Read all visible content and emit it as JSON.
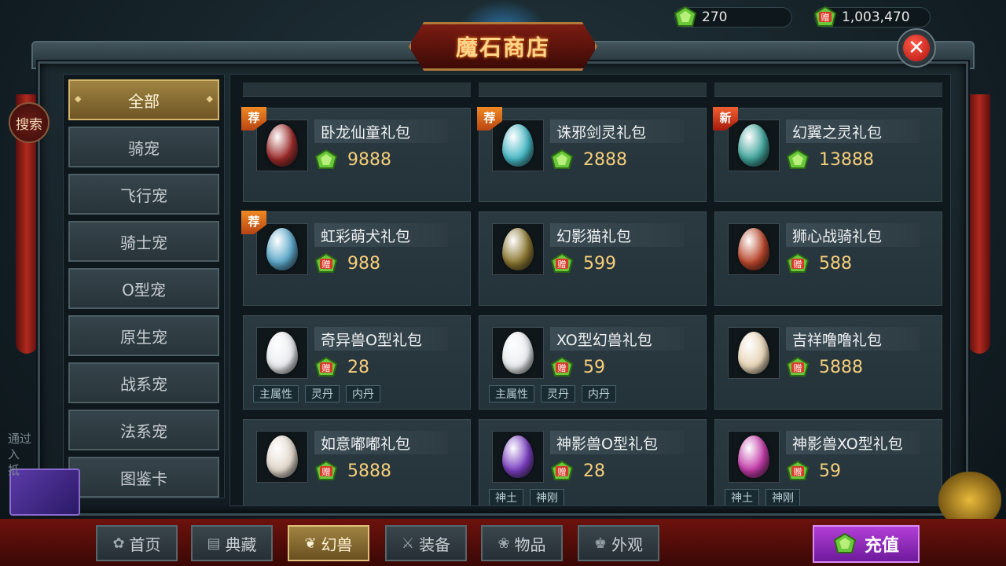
{
  "title": "魔石商店",
  "currency": {
    "stone": "270",
    "bind": "1,003,470",
    "bind_badge": "赠"
  },
  "search_label": "搜索",
  "close_label": "✕",
  "side_text": "通过\n入\n抵",
  "sidebar": {
    "items": [
      {
        "label": "全部",
        "active": true
      },
      {
        "label": "骑宠"
      },
      {
        "label": "飞行宠"
      },
      {
        "label": "骑士宠"
      },
      {
        "label": "O型宠"
      },
      {
        "label": "原生宠"
      },
      {
        "label": "战系宠"
      },
      {
        "label": "法系宠"
      },
      {
        "label": "图鉴卡"
      }
    ]
  },
  "cards": [
    {
      "name": "卧龙仙童礼包",
      "price": "9888",
      "currency": "stone",
      "badge": "荐",
      "egg": "#9b2a2a"
    },
    {
      "name": "诛邪剑灵礼包",
      "price": "2888",
      "currency": "stone",
      "badge": "荐",
      "egg": "#47b8c4"
    },
    {
      "name": "幻翼之灵礼包",
      "price": "13888",
      "currency": "stone",
      "badge": "新",
      "egg": "#3fa39a"
    },
    {
      "name": "虹彩萌犬礼包",
      "price": "988",
      "currency": "bind",
      "badge": "荐",
      "egg": "#5aa6c8"
    },
    {
      "name": "幻影猫礼包",
      "price": "599",
      "currency": "bind",
      "badge": "",
      "egg": "#8a7630"
    },
    {
      "name": "狮心战骑礼包",
      "price": "588",
      "currency": "bind",
      "badge": "",
      "egg": "#b8452a"
    },
    {
      "name": "奇异兽O型礼包",
      "price": "28",
      "currency": "bind",
      "badge": "",
      "egg": "#e9ecef",
      "tags": [
        "主属性",
        "灵丹",
        "内丹"
      ]
    },
    {
      "name": "XO型幻兽礼包",
      "price": "59",
      "currency": "bind",
      "badge": "",
      "egg": "#e9ecef",
      "tags": [
        "主属性",
        "灵丹",
        "内丹"
      ]
    },
    {
      "name": "吉祥噜噜礼包",
      "price": "5888",
      "currency": "bind",
      "badge": "",
      "egg": "#e8d6b8"
    },
    {
      "name": "如意嘟嘟礼包",
      "price": "5888",
      "currency": "bind",
      "badge": "",
      "egg": "#e2d8cc"
    },
    {
      "name": "神影兽O型礼包",
      "price": "28",
      "currency": "bind",
      "badge": "",
      "egg": "#7a3fc0",
      "tags": [
        "神土",
        "神刚"
      ]
    },
    {
      "name": "神影兽XO型礼包",
      "price": "59",
      "currency": "bind",
      "badge": "",
      "egg": "#c23aa8",
      "tags": [
        "神土",
        "神刚"
      ]
    }
  ],
  "tabs": [
    {
      "label": "首页",
      "icon": "✿"
    },
    {
      "label": "典藏",
      "icon": "▤"
    },
    {
      "label": "幻兽",
      "icon": "❦",
      "active": true
    },
    {
      "label": "装备",
      "icon": "⚔"
    },
    {
      "label": "物品",
      "icon": "❀"
    },
    {
      "label": "外观",
      "icon": "♚"
    }
  ],
  "recharge_label": "充值",
  "colors": {
    "accent_gold": "#a08442",
    "price_gold": "#f6cf7a",
    "stone_green": "#6bc83a",
    "bind_red": "#d93a2a",
    "recharge_purple": "#9a2fcf"
  }
}
